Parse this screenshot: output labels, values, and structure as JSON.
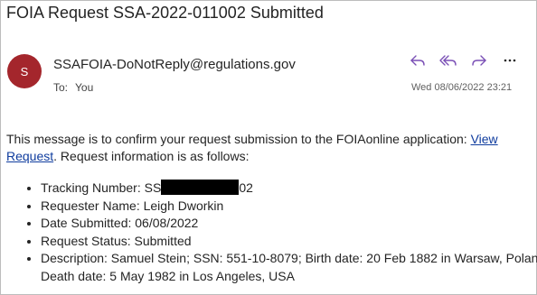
{
  "email": {
    "subject": "FOIA Request SSA-2022-011002 Submitted",
    "avatar_initial": "S",
    "avatar_color": "#a4262c",
    "sender": "SSAFOIA-DoNotReply@regulations.gov",
    "to_label": "To:",
    "to_value": "You",
    "date": "Wed 08/06/2022 23:21",
    "actions": [
      {
        "name": "reply",
        "icon": "reply-icon"
      },
      {
        "name": "reply-all",
        "icon": "reply-all-icon"
      },
      {
        "name": "forward",
        "icon": "forward-icon"
      },
      {
        "name": "more",
        "icon": "more-icon"
      }
    ],
    "intro_before_link": "This message is to confirm your request submission to the FOIAonline application: ",
    "link_text": "View Request",
    "intro_after_link": ". Request information is as follows:",
    "details": {
      "tracking_label": "Tracking Number: SS",
      "tracking_suffix": "02",
      "requester": "Requester Name: Leigh Dworkin",
      "date_submitted": "Date Submitted: 06/08/2022",
      "status": "Request Status: Submitted",
      "description": "Description: Samuel Stein; SSN: 551-10-8079; Birth date: 20 Feb 1882 in Warsaw, Poland; Death date: 5 May 1982 in Los Angeles, USA"
    }
  }
}
